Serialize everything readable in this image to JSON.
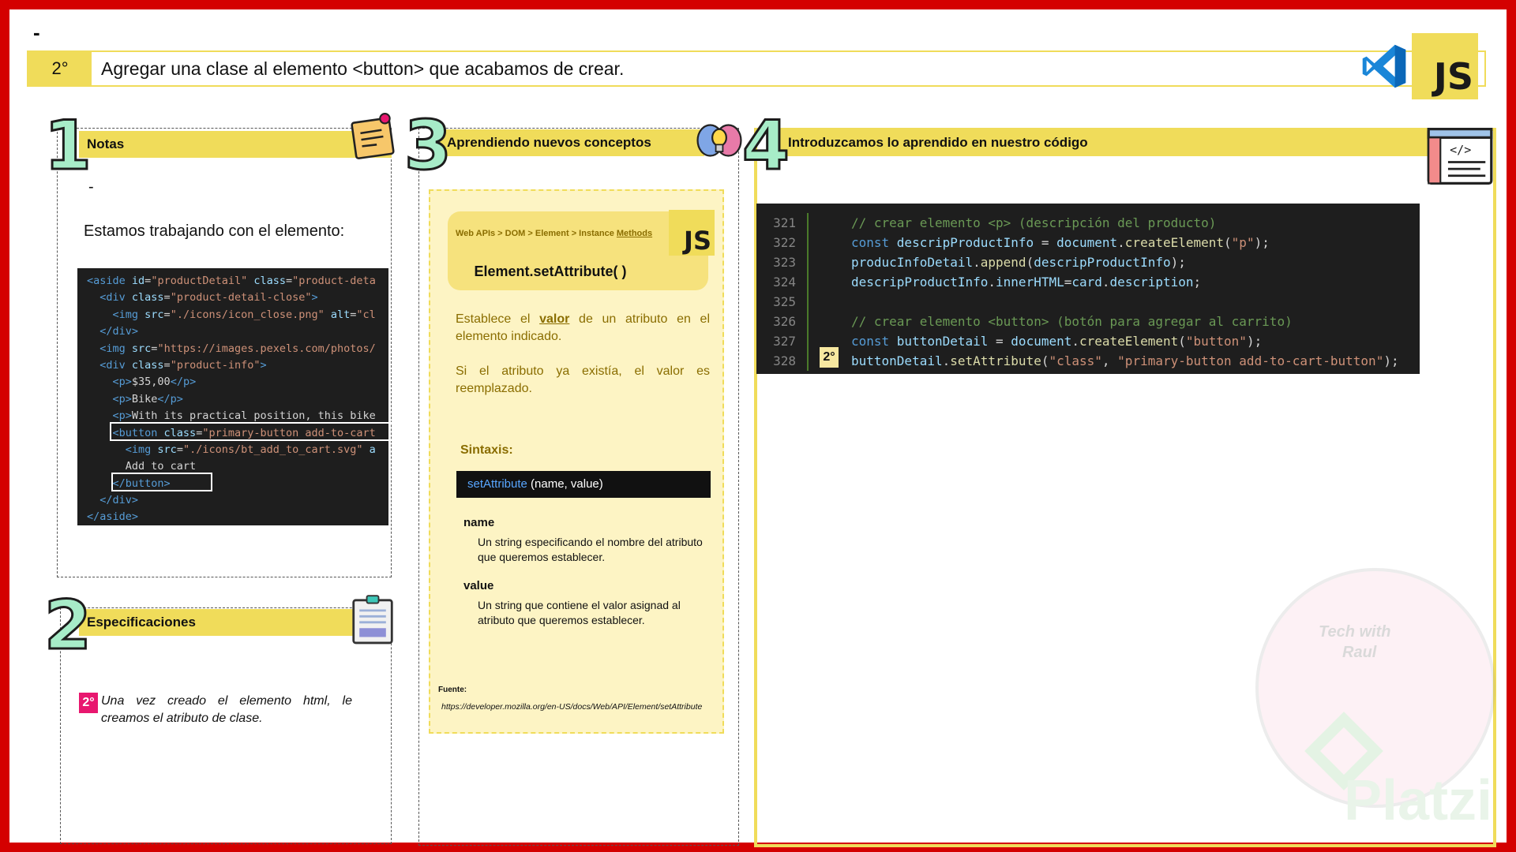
{
  "header": {
    "dash": "-",
    "step_number": "2°",
    "title": "Agregar una clase al elemento <button> que acabamos de crear.",
    "logo_text": "JS"
  },
  "notes": {
    "number": "1",
    "title": "Notas",
    "dash": "-",
    "intro": "Estamos trabajando con el elemento:",
    "code_lines": [
      [
        {
          "c": "c-tag",
          "t": "<aside "
        },
        {
          "c": "c-attr",
          "t": "id"
        },
        {
          "c": "c-txt",
          "t": "="
        },
        {
          "c": "c-str",
          "t": "\"productDetail\""
        },
        {
          "c": "c-attr",
          "t": " class"
        },
        {
          "c": "c-txt",
          "t": "="
        },
        {
          "c": "c-str",
          "t": "\"product-deta"
        }
      ],
      [
        {
          "c": "c-txt",
          "t": "  "
        },
        {
          "c": "c-tag",
          "t": "<div "
        },
        {
          "c": "c-attr",
          "t": "class"
        },
        {
          "c": "c-txt",
          "t": "="
        },
        {
          "c": "c-str",
          "t": "\"product-detail-close\""
        },
        {
          "c": "c-tag",
          "t": ">"
        }
      ],
      [
        {
          "c": "c-txt",
          "t": "    "
        },
        {
          "c": "c-tag",
          "t": "<img "
        },
        {
          "c": "c-attr",
          "t": "src"
        },
        {
          "c": "c-txt",
          "t": "="
        },
        {
          "c": "c-str",
          "t": "\"./icons/icon_close.png\""
        },
        {
          "c": "c-attr",
          "t": " alt"
        },
        {
          "c": "c-txt",
          "t": "="
        },
        {
          "c": "c-str",
          "t": "\"cl"
        }
      ],
      [
        {
          "c": "c-txt",
          "t": "  "
        },
        {
          "c": "c-tag",
          "t": "</div>"
        }
      ],
      [
        {
          "c": "c-txt",
          "t": "  "
        },
        {
          "c": "c-tag",
          "t": "<img "
        },
        {
          "c": "c-attr",
          "t": "src"
        },
        {
          "c": "c-txt",
          "t": "="
        },
        {
          "c": "c-str",
          "t": "\"https://images.pexels.com/photos/"
        }
      ],
      [
        {
          "c": "c-txt",
          "t": "  "
        },
        {
          "c": "c-tag",
          "t": "<div "
        },
        {
          "c": "c-attr",
          "t": "class"
        },
        {
          "c": "c-txt",
          "t": "="
        },
        {
          "c": "c-str",
          "t": "\"product-info\""
        },
        {
          "c": "c-tag",
          "t": ">"
        }
      ],
      [
        {
          "c": "c-txt",
          "t": "    "
        },
        {
          "c": "c-tag",
          "t": "<p>"
        },
        {
          "c": "c-txt",
          "t": "$35,00"
        },
        {
          "c": "c-tag",
          "t": "</p>"
        }
      ],
      [
        {
          "c": "c-txt",
          "t": "    "
        },
        {
          "c": "c-tag",
          "t": "<p>"
        },
        {
          "c": "c-txt",
          "t": "Bike"
        },
        {
          "c": "c-tag",
          "t": "</p>"
        }
      ],
      [
        {
          "c": "c-txt",
          "t": "    "
        },
        {
          "c": "c-tag",
          "t": "<p>"
        },
        {
          "c": "c-txt",
          "t": "With its practical position, this bike"
        }
      ],
      [
        {
          "c": "c-txt",
          "t": "    "
        },
        {
          "c": "c-tag",
          "t": "<button "
        },
        {
          "c": "c-attr",
          "t": "class"
        },
        {
          "c": "c-txt",
          "t": "="
        },
        {
          "c": "c-str",
          "t": "\"primary-button add-to-cart"
        }
      ],
      [
        {
          "c": "c-txt",
          "t": "      "
        },
        {
          "c": "c-tag",
          "t": "<img "
        },
        {
          "c": "c-attr",
          "t": "src"
        },
        {
          "c": "c-txt",
          "t": "="
        },
        {
          "c": "c-str",
          "t": "\"./icons/bt_add_to_cart.svg\""
        },
        {
          "c": "c-attr",
          "t": " a"
        }
      ],
      [
        {
          "c": "c-txt",
          "t": "      Add to cart"
        }
      ],
      [
        {
          "c": "c-txt",
          "t": "    "
        },
        {
          "c": "c-tag",
          "t": "</button>"
        }
      ],
      [
        {
          "c": "c-txt",
          "t": "  "
        },
        {
          "c": "c-tag",
          "t": "</div>"
        }
      ],
      [
        {
          "c": "c-tag",
          "t": "</aside>"
        }
      ]
    ]
  },
  "specs": {
    "number": "2",
    "title": "Especificaciones",
    "badge": "2°",
    "text": "Una vez creado el elemento html, le creamos el atributo de clase."
  },
  "concepts": {
    "number": "3",
    "title": "Aprendiendo nuevos conceptos",
    "breadcrumb_prefix": "Web APIs > DOM > Element > Instance ",
    "breadcrumb_link": "Methods",
    "logo_text": "JS",
    "method_title": "Element.setAttribute( )",
    "desc1_pre": "Establece el ",
    "desc1_bold": "valor",
    "desc1_post": " de un atributo en el elemento indicado.",
    "desc2": "Si el atributo ya existía, el valor es reemplazado.",
    "syntax_label": "Sintaxis:",
    "syntax_fn": "setAttribute",
    "syntax_args": " (name, value)",
    "param1_name": "name",
    "param1_desc": "Un string especificando el nombre del atributo que queremos establecer.",
    "param2_name": "value",
    "param2_desc": "Un string que contiene el valor asignad al atributo que queremos establecer.",
    "source_label": "Fuente:",
    "source_url": "https://developer.mozilla.org/en-US/docs/Web/API/Element/setAttribute"
  },
  "code_panel": {
    "number": "4",
    "title": "Introduzcamos lo aprendido en nuestro código",
    "badge": "2°",
    "lines": [
      {
        "n": "321",
        "parts": [
          {
            "c": "c-com",
            "t": "// crear elemento <p> (descripción del producto)"
          }
        ]
      },
      {
        "n": "322",
        "parts": [
          {
            "c": "c-kw",
            "t": "const "
          },
          {
            "c": "c-var",
            "t": "descripProductInfo"
          },
          {
            "c": "c-punc",
            "t": " = "
          },
          {
            "c": "c-var",
            "t": "document"
          },
          {
            "c": "c-punc",
            "t": "."
          },
          {
            "c": "c-fn",
            "t": "createElement"
          },
          {
            "c": "c-punc",
            "t": "("
          },
          {
            "c": "c-str",
            "t": "\"p\""
          },
          {
            "c": "c-punc",
            "t": ");"
          }
        ]
      },
      {
        "n": "323",
        "parts": [
          {
            "c": "c-var",
            "t": "producInfoDetail"
          },
          {
            "c": "c-punc",
            "t": "."
          },
          {
            "c": "c-fn",
            "t": "append"
          },
          {
            "c": "c-punc",
            "t": "("
          },
          {
            "c": "c-var",
            "t": "descripProductInfo"
          },
          {
            "c": "c-punc",
            "t": ");"
          }
        ]
      },
      {
        "n": "324",
        "parts": [
          {
            "c": "c-var",
            "t": "descripProductInfo"
          },
          {
            "c": "c-punc",
            "t": "."
          },
          {
            "c": "c-var",
            "t": "innerHTML"
          },
          {
            "c": "c-punc",
            "t": "="
          },
          {
            "c": "c-var",
            "t": "card"
          },
          {
            "c": "c-punc",
            "t": "."
          },
          {
            "c": "c-var",
            "t": "description"
          },
          {
            "c": "c-punc",
            "t": ";"
          }
        ]
      },
      {
        "n": "325",
        "parts": []
      },
      {
        "n": "326",
        "parts": [
          {
            "c": "c-com",
            "t": "// crear elemento <button> (botón para agregar al carrito)"
          }
        ]
      },
      {
        "n": "327",
        "parts": [
          {
            "c": "c-kw",
            "t": "const "
          },
          {
            "c": "c-var",
            "t": "buttonDetail"
          },
          {
            "c": "c-punc",
            "t": " = "
          },
          {
            "c": "c-var",
            "t": "document"
          },
          {
            "c": "c-punc",
            "t": "."
          },
          {
            "c": "c-fn",
            "t": "createElement"
          },
          {
            "c": "c-punc",
            "t": "("
          },
          {
            "c": "c-str",
            "t": "\"button\""
          },
          {
            "c": "c-punc",
            "t": ");"
          }
        ]
      },
      {
        "n": "328",
        "parts": [
          {
            "c": "c-var",
            "t": "buttonDetail"
          },
          {
            "c": "c-punc",
            "t": "."
          },
          {
            "c": "c-fn",
            "t": "setAttribute"
          },
          {
            "c": "c-punc",
            "t": "("
          },
          {
            "c": "c-str",
            "t": "\"class\""
          },
          {
            "c": "c-punc",
            "t": ", "
          },
          {
            "c": "c-str",
            "t": "\"primary-button add-to-cart-button\""
          },
          {
            "c": "c-punc",
            "t": ");"
          }
        ]
      }
    ]
  },
  "watermark": {
    "line1": "Tech with",
    "line2": "Raul",
    "brand": "Platzi"
  },
  "colors": {
    "frame": "#d40000",
    "accent_yellow": "#f0dc5a",
    "number_green": "#a7ecc8",
    "badge_pink": "#e8176f"
  }
}
